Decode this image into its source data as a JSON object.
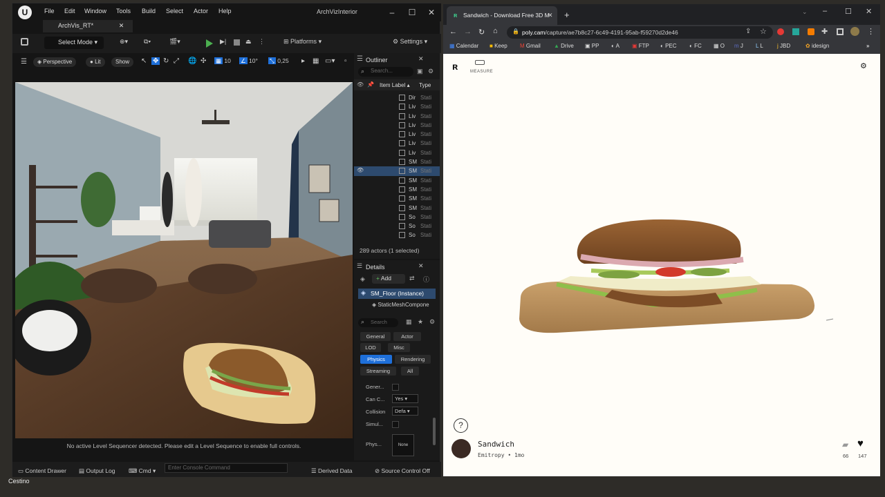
{
  "desktop": {
    "label": "Cestino"
  },
  "ue": {
    "app_title": "ArchVizInterior",
    "logo": "U",
    "menu": [
      "File",
      "Edit",
      "Window",
      "Tools",
      "Build",
      "Select",
      "Actor",
      "Help"
    ],
    "tab": "ArchVis_RT*",
    "toolbar": {
      "select_mode": "Select Mode",
      "platforms": "Platforms",
      "settings": "Settings"
    },
    "viewport": {
      "perspective": "Perspective",
      "lit": "Lit",
      "show": "Show",
      "grid_snap": "10",
      "angle_snap": "10°",
      "scale_snap": "0,25",
      "message": "No active Level Sequencer detected. Please edit a Level Sequence to enable full controls."
    },
    "outliner": {
      "title": "Outliner",
      "search_placeholder": "Search...",
      "col_label": "Item Label",
      "col_type": "Type",
      "rows": [
        {
          "label": "Dir",
          "type": "Stati"
        },
        {
          "label": "Liv",
          "type": "Stati"
        },
        {
          "label": "Liv",
          "type": "Stati"
        },
        {
          "label": "Liv",
          "type": "Stati"
        },
        {
          "label": "Liv",
          "type": "Stati"
        },
        {
          "label": "Liv",
          "type": "Stati"
        },
        {
          "label": "Liv",
          "type": "Stati"
        },
        {
          "label": "SM",
          "type": "Stati"
        },
        {
          "label": "SM",
          "type": "Stati"
        },
        {
          "label": "SM",
          "type": "Stati"
        },
        {
          "label": "SM",
          "type": "Stati"
        },
        {
          "label": "SM",
          "type": "Stati"
        },
        {
          "label": "SM",
          "type": "Stati"
        },
        {
          "label": "So",
          "type": "Stati"
        },
        {
          "label": "So",
          "type": "Stati"
        },
        {
          "label": "So",
          "type": "Stati"
        }
      ],
      "count": "289 actors (1 selected)"
    },
    "details": {
      "title": "Details",
      "add": "Add",
      "instance": "SM_Floor (Instance)",
      "component": "StaticMeshCompone",
      "search_placeholder": "Search",
      "filters": [
        "General",
        "Actor",
        "LOD",
        "Misc",
        "Physics",
        "Rendering",
        "Streaming",
        "All"
      ],
      "props": [
        {
          "name": "Gener...",
          "value": ""
        },
        {
          "name": "Can C...",
          "value": "Yes"
        },
        {
          "name": "Collision",
          "value": "Defa"
        },
        {
          "name": "Simul...",
          "value": ""
        },
        {
          "name": "Phys...",
          "value": "None"
        }
      ]
    },
    "bottom": {
      "content_drawer": "Content Drawer",
      "output_log": "Output Log",
      "cmd": "Cmd",
      "console_placeholder": "Enter Console Command",
      "derived_data": "Derived Data",
      "source_control": "Source Control Off"
    }
  },
  "chrome": {
    "tab_title": "Sandwich - Download Free 3D M",
    "url_host": "poly.cam",
    "url_path": "/capture/ae7b8c27-6c49-4191-95ab-f59270d2de46",
    "bookmarks": [
      "Calendar",
      "Keep",
      "Gmail",
      "Drive",
      "PP",
      "A",
      "FTP",
      "PEC",
      "FC",
      "O",
      "J",
      "L",
      "JBD",
      "idesign"
    ]
  },
  "polycam": {
    "measure": "MEASURE",
    "help": "?",
    "title": "Sandwich",
    "author": "Emitropy",
    "age": "1mo",
    "saves": "66",
    "likes": "147"
  }
}
